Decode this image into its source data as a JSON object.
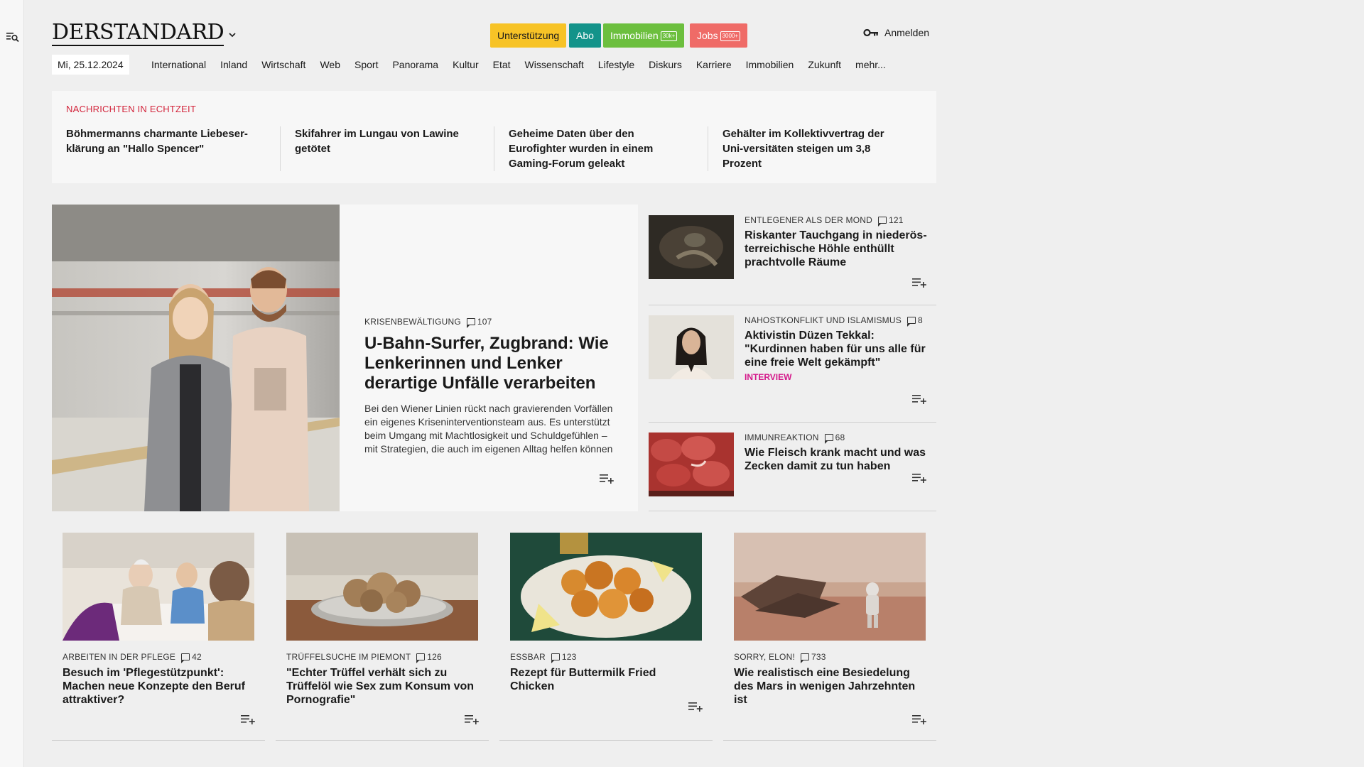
{
  "logo": "DERSTANDARD",
  "header": {
    "support": "Unterstützung",
    "abo": "Abo",
    "immo": "Immobilien",
    "immo_badge": "30k+",
    "jobs": "Jobs",
    "jobs_badge": "3000+",
    "login": "Anmelden"
  },
  "date": "Mi, 25.12.2024",
  "nav": [
    "International",
    "Inland",
    "Wirtschaft",
    "Web",
    "Sport",
    "Panorama",
    "Kultur",
    "Etat",
    "Wissenschaft",
    "Lifestyle",
    "Diskurs",
    "Karriere",
    "Immobilien",
    "Zukunft",
    "mehr..."
  ],
  "ticker": {
    "title": "NACHRICHTEN IN ECHTZEIT",
    "items": [
      "Böhmermanns charmante Liebeser-klärung an \"Hallo Spencer\"",
      "Skifahrer im Lungau von Lawine getötet",
      "Geheime Daten über den Eurofighter wurden in einem Gaming-Forum geleakt",
      "Gehälter im Kollektivvertrag der Uni-versitäten steigen um 3,8 Prozent"
    ]
  },
  "lead": {
    "kicker": "KRISENBEWÄLTIGUNG",
    "comments": "107",
    "title": "U-Bahn-Surfer, Zugbrand: Wie Lenkerinnen und Lenker derartige Unfälle verarbeiten",
    "teaser": "Bei den Wiener Linien rückt nach gravierenden Vorfällen ein eigenes Kriseninterventionsteam aus. Es unterstützt beim Umgang mit Machtlosigkeit und Schuldgefühlen – mit Strategien, die auch im eigenen Alltag helfen können"
  },
  "side": [
    {
      "kicker": "ENTLEGENER ALS DER MOND",
      "comments": "121",
      "title": "Riskanter Tauchgang in niederös-terreichische Höhle enthüllt prachtvolle Räume",
      "tag": ""
    },
    {
      "kicker": "NAHOSTKONFLIKT UND ISLAMISMUS",
      "comments": "8",
      "title": "Aktivistin Düzen Tekkal: \"Kurdinnen haben für uns alle für eine freie Welt gekämpft\"",
      "tag": "INTERVIEW"
    },
    {
      "kicker": "IMMUNREAKTION",
      "comments": "68",
      "title": "Wie Fleisch krank macht und was Zecken damit zu tun haben",
      "tag": ""
    }
  ],
  "cards": [
    {
      "kicker": "ARBEITEN IN DER PFLEGE",
      "comments": "42",
      "title": "Besuch im 'Pflegestützpunkt': Machen neue Konzepte den Beruf attraktiver?"
    },
    {
      "kicker": "TRÜFFELSUCHE IM PIEMONT",
      "comments": "126",
      "title": "\"Echter Trüffel verhält sich zu Trüffelöl wie Sex zum Konsum von Pornografie\""
    },
    {
      "kicker": "ESSBAR",
      "comments": "123",
      "title": "Rezept für Buttermilk Fried Chicken"
    },
    {
      "kicker": "SORRY, ELON!",
      "comments": "733",
      "title": "Wie realistisch eine Besiedelung des Mars in wenigen Jahrzehnten ist"
    }
  ],
  "icons": {
    "menu": "menu-search-icon",
    "chevron": "chevron-down-icon",
    "key": "key-icon",
    "comment": "comment-icon",
    "playlist_add": "playlist-add-icon"
  },
  "colors": {
    "support": "#f7c326",
    "abo": "#13938a",
    "immo": "#6cbf3e",
    "jobs": "#ef6b67",
    "ticker_title": "#d3253c",
    "interview": "#d4178a"
  }
}
